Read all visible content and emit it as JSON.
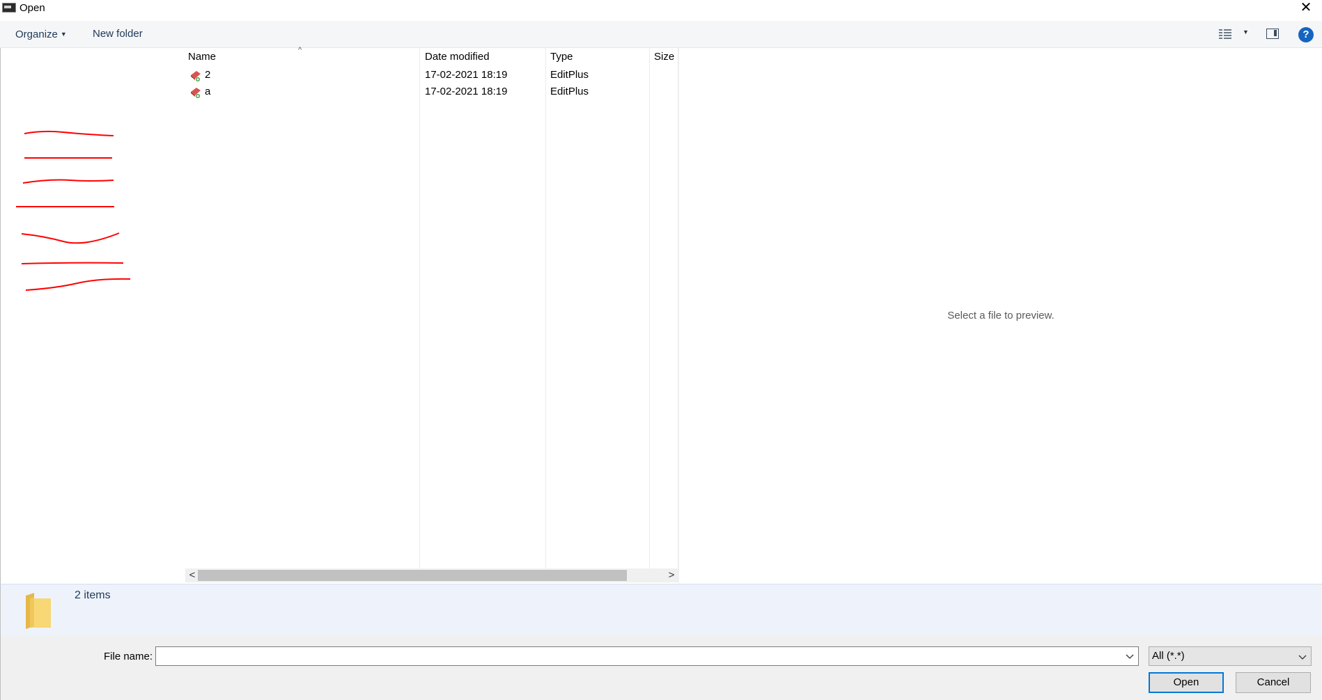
{
  "window": {
    "title": "Open",
    "close_glyph": "✕"
  },
  "toolbar": {
    "organize_label": "Organize",
    "new_folder_label": "New folder",
    "help_label": "?",
    "icons": [
      "details-view-icon",
      "dropdown-caret-icon",
      "preview-pane-icon",
      "help-icon"
    ]
  },
  "file_list": {
    "columns": [
      "Name",
      "Date modified",
      "Type",
      "Size"
    ],
    "sort_indicator": "^",
    "rows": [
      {
        "name": "2",
        "date_modified": "17-02-2021 18:19",
        "type": "EditPlus",
        "size": ""
      },
      {
        "name": "a",
        "date_modified": "17-02-2021 18:19",
        "type": "EditPlus",
        "size": ""
      }
    ]
  },
  "scrollbar": {
    "left_glyph": "<",
    "right_glyph": ">"
  },
  "preview": {
    "message": "Select a file to preview."
  },
  "details": {
    "items_count": "2 items"
  },
  "bottom": {
    "file_name_label": "File name:",
    "file_name_value": "",
    "filter_value": "All (*.*)",
    "open_label": "Open",
    "cancel_label": "Cancel"
  },
  "colors": {
    "accent": "#0078d7",
    "toolbar_text": "#1e3959",
    "details_bg": "#eef3fb",
    "redaction": "#ff0000",
    "help": "#1565c0"
  }
}
